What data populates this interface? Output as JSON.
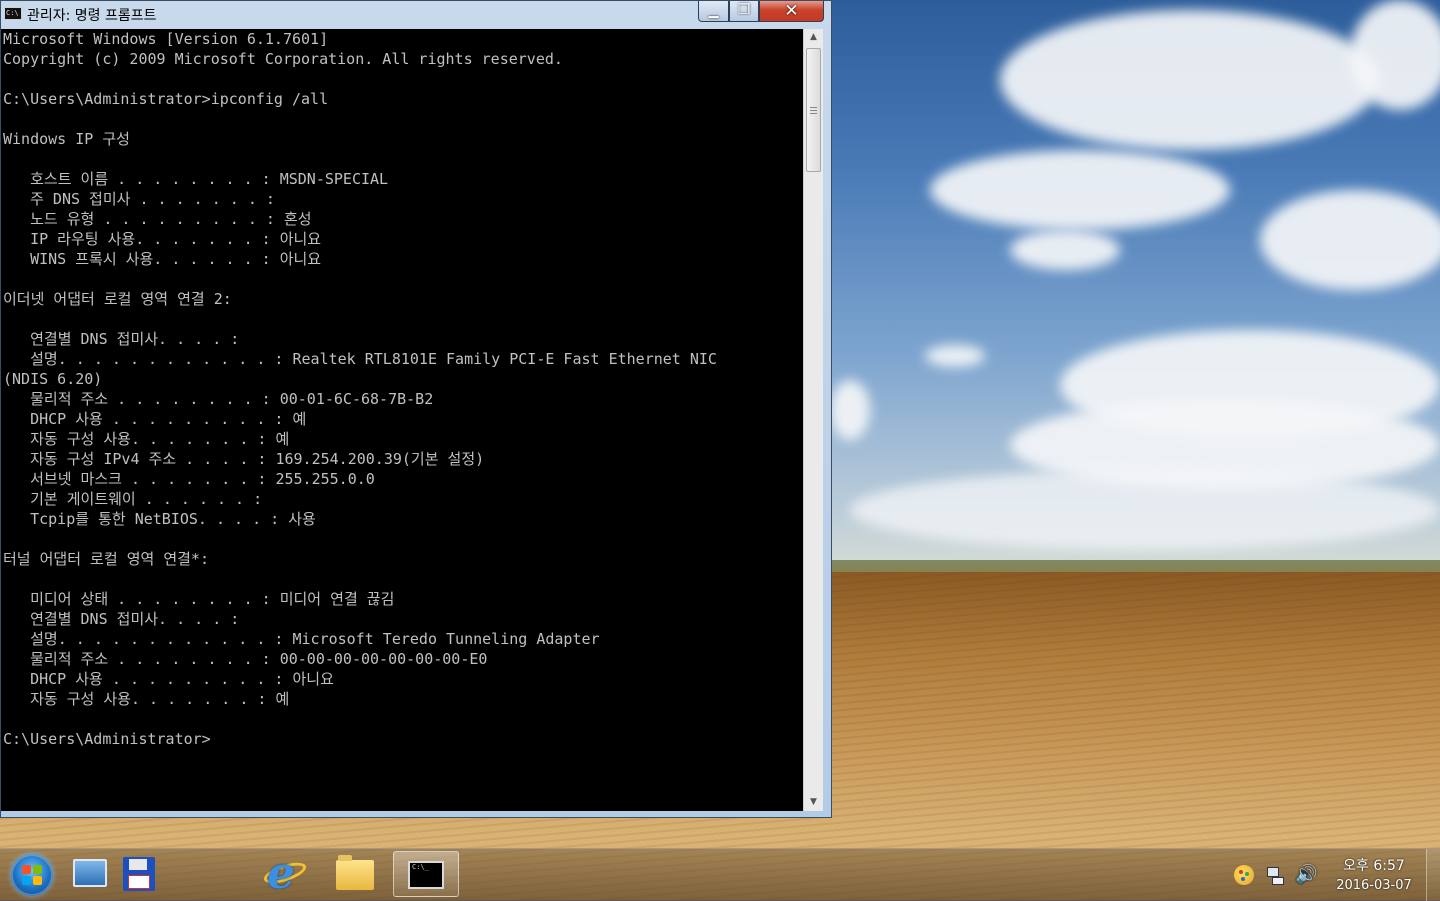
{
  "window": {
    "title": "관리자: 명령 프롬프트",
    "controls": {
      "minimize": "▁",
      "maximize": "❐",
      "close": "✕"
    }
  },
  "console": {
    "lines": [
      "Microsoft Windows [Version 6.1.7601]",
      "Copyright (c) 2009 Microsoft Corporation. All rights reserved.",
      "",
      "C:\\Users\\Administrator>ipconfig /all",
      "",
      "Windows IP 구성",
      "",
      "   호스트 이름 . . . . . . . . : MSDN-SPECIAL",
      "   주 DNS 접미사 . . . . . . . :",
      "   노드 유형 . . . . . . . . . : 혼성",
      "   IP 라우팅 사용. . . . . . . : 아니요",
      "   WINS 프록시 사용. . . . . . : 아니요",
      "",
      "이더넷 어댑터 로컬 영역 연결 2:",
      "",
      "   연결별 DNS 접미사. . . . :",
      "   설명. . . . . . . . . . . . : Realtek RTL8101E Family PCI-E Fast Ethernet NIC",
      "(NDIS 6.20)",
      "   물리적 주소 . . . . . . . . : 00-01-6C-68-7B-B2",
      "   DHCP 사용 . . . . . . . . . : 예",
      "   자동 구성 사용. . . . . . . : 예",
      "   자동 구성 IPv4 주소 . . . . : 169.254.200.39(기본 설정)",
      "   서브넷 마스크 . . . . . . . : 255.255.0.0",
      "   기본 게이트웨이 . . . . . . :",
      "   Tcpip를 통한 NetBIOS. . . . : 사용",
      "",
      "터널 어댑터 로컬 영역 연결*:",
      "",
      "   미디어 상태 . . . . . . . . : 미디어 연결 끊김",
      "   연결별 DNS 접미사. . . . :",
      "   설명. . . . . . . . . . . . : Microsoft Teredo Tunneling Adapter",
      "   물리적 주소 . . . . . . . . : 00-00-00-00-00-00-00-E0",
      "   DHCP 사용 . . . . . . . . . : 아니요",
      "   자동 구성 사용. . . . . . . : 예",
      "",
      "C:\\Users\\Administrator>"
    ]
  },
  "scrollbar": {
    "up": "▲",
    "down": "▼"
  },
  "taskbar": {
    "items": [
      {
        "name": "start-orb",
        "icon": "windows-logo-icon"
      },
      {
        "name": "show-desktop",
        "icon": "desktop-icon"
      },
      {
        "name": "save",
        "icon": "floppy-disk-icon"
      },
      {
        "name": "internet-explorer",
        "icon": "internet-explorer-icon",
        "glyph": "e"
      },
      {
        "name": "file-explorer",
        "icon": "folder-icon"
      },
      {
        "name": "command-prompt",
        "icon": "cmd-icon",
        "active": true,
        "glyph": "C:\\_"
      }
    ],
    "tray": {
      "volume_glyph": "🔊",
      "clock_time": "오후 6:57",
      "clock_date": "2016-03-07"
    }
  },
  "colors": {
    "console_text": "#c0c0c0",
    "console_bg": "#000000",
    "close_button": "#c9422b"
  }
}
